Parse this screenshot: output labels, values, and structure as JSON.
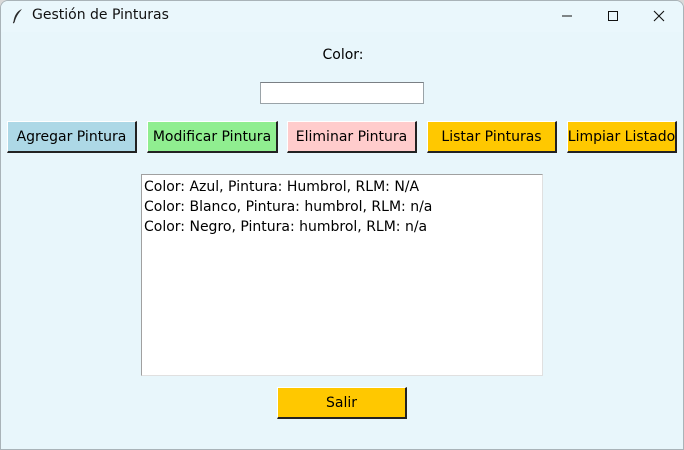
{
  "window": {
    "title": "Gestión de Pinturas"
  },
  "form": {
    "color_label": "Color:",
    "color_value": "",
    "color_placeholder": ""
  },
  "buttons": {
    "agregar": "Agregar Pintura",
    "modificar": "Modificar Pintura",
    "eliminar": "Eliminar Pintura",
    "listar": "Listar Pinturas",
    "limpiar": "Limpiar Listado",
    "salir": "Salir"
  },
  "list": {
    "items": [
      "Color: Azul, Pintura: Humbrol, RLM: N/A",
      "Color: Blanco, Pintura: humbrol, RLM: n/a",
      "Color: Negro, Pintura: humbrol, RLM: n/a"
    ]
  },
  "colors": {
    "background": "#e8f6fb",
    "agregar": "#add8e6",
    "modificar": "#90ee90",
    "eliminar": "#ffcccc",
    "listar": "#ffc800",
    "limpiar": "#ffc800",
    "salir": "#ffc800"
  },
  "icons": {
    "app": "feather-icon",
    "minimize": "minimize-icon",
    "maximize": "maximize-icon",
    "close": "close-icon"
  }
}
